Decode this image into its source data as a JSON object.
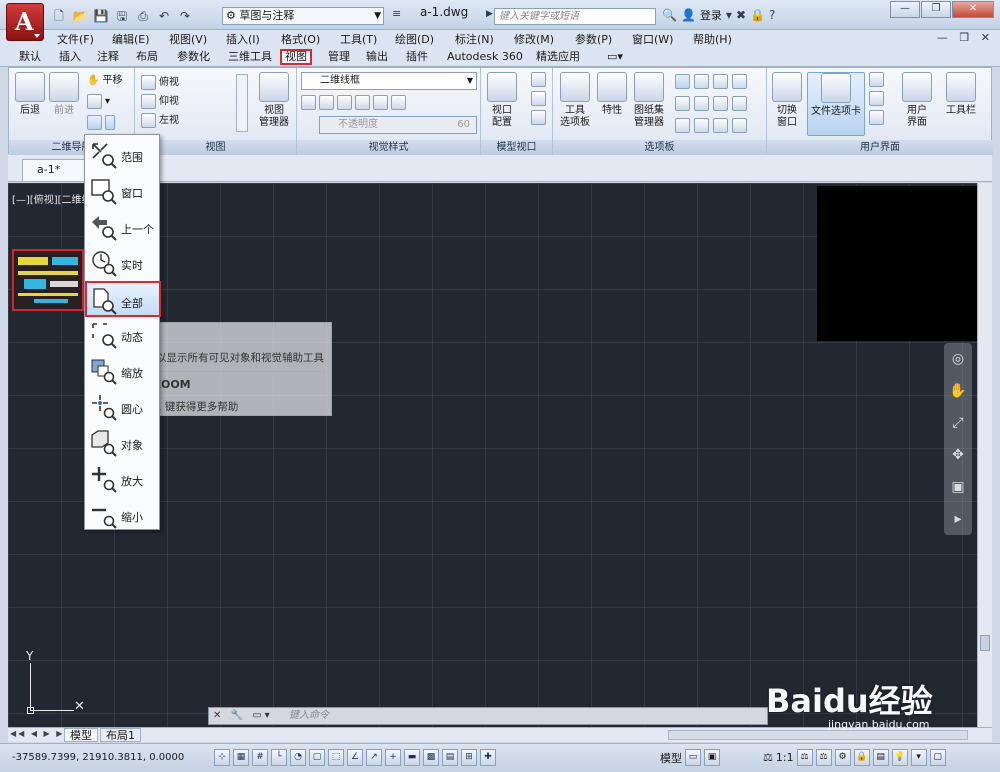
{
  "titlebar": {
    "workspace": "草图与注释",
    "file_title": "a-1.dwg",
    "search_placeholder": "键入关键字或短语",
    "login": "登录"
  },
  "menu": [
    "文件(F)",
    "编辑(E)",
    "视图(V)",
    "插入(I)",
    "格式(O)",
    "工具(T)",
    "绘图(D)",
    "标注(N)",
    "修改(M)",
    "参数(P)",
    "窗口(W)",
    "帮助(H)"
  ],
  "ribbon_tabs": [
    "默认",
    "插入",
    "注释",
    "布局",
    "参数化",
    "三维工具",
    "视图",
    "管理",
    "输出",
    "插件",
    "Autodesk 360",
    "精选应用"
  ],
  "active_tab": "视图",
  "ribbon": {
    "nav": {
      "back": "后退",
      "forward": "前进",
      "pan": "平移",
      "title": "二维导航"
    },
    "views": {
      "items": [
        "俯视",
        "仰视",
        "左视"
      ],
      "manager": "视图\n管理器",
      "title": "视图"
    },
    "visual_styles": {
      "style": "二维线框",
      "opacity_placeholder": "不透明度",
      "opacity_value": "60",
      "title": "视觉样式"
    },
    "model_viewports": {
      "config": "视口\n配置",
      "title": "模型视口"
    },
    "palettes": {
      "tool_palettes": "工具\n选项板",
      "properties": "特性",
      "sheet_set": "图纸集\n管理器",
      "title": "选项板"
    },
    "ui": {
      "switch_window": "切换\n窗口",
      "file_tabs": "文件选项卡",
      "ui": "用户\n界面",
      "toolbars": "工具栏",
      "title": "用户界面"
    }
  },
  "doc_tab": "a-1*",
  "viewport_label": "[—][俯视][二维线",
  "zoom_menu": [
    {
      "label": "范围",
      "icon": "zoom-extents-icon"
    },
    {
      "label": "窗口",
      "icon": "zoom-window-icon"
    },
    {
      "label": "上一个",
      "icon": "zoom-previous-icon"
    },
    {
      "label": "实时",
      "icon": "zoom-realtime-icon"
    },
    {
      "label": "全部",
      "icon": "zoom-all-icon"
    },
    {
      "label": "动态",
      "icon": "zoom-dynamic-icon"
    },
    {
      "label": "缩放",
      "icon": "zoom-scale-icon"
    },
    {
      "label": "圆心",
      "icon": "zoom-center-icon"
    },
    {
      "label": "对象",
      "icon": "zoom-object-icon"
    },
    {
      "label": "放大",
      "icon": "zoom-in-icon"
    },
    {
      "label": "缩小",
      "icon": "zoom-out-icon"
    }
  ],
  "selected_zoom": "全部",
  "tooltip": {
    "title": "全部",
    "desc": "缩放以显示所有可见对象和视觉辅助工具",
    "command": "ZOOM",
    "help": "按 F1 键获得更多帮助"
  },
  "command_placeholder": "键入命令",
  "layout_tabs": [
    "模型",
    "布局1"
  ],
  "status": {
    "coords": "-37589.7399, 21910.3811, 0.0000",
    "model": "模型",
    "scale": "1:1"
  },
  "watermark": {
    "logo": "Baidu经验",
    "url": "jingyan.baidu.com"
  },
  "colors": {
    "accent_red": "#e0282a",
    "canvas": "#212830",
    "ribbon": "#dbe5f1"
  }
}
